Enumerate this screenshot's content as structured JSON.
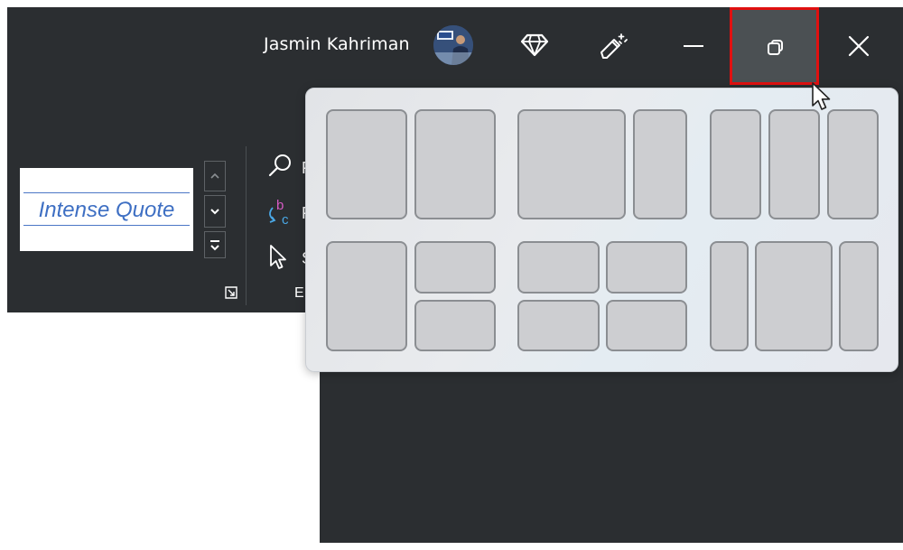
{
  "titlebar": {
    "user_name": "Jasmin Kahriman",
    "avatar": "user-avatar",
    "icons": [
      "diamond-icon",
      "pen-sparkle-icon",
      "minimize-icon",
      "restore-icon",
      "close-icon"
    ],
    "highlight_color": "#e01010"
  },
  "ribbon": {
    "style_gallery": {
      "selected_style": "Intense Quote"
    },
    "editing": {
      "find_label": "F",
      "replace_label": "F",
      "select_label": "S",
      "group_label": "E"
    }
  },
  "snap_layouts": {
    "layouts": [
      {
        "name": "two-equal-columns",
        "zones": 2
      },
      {
        "name": "wide-left-narrow-right",
        "zones": 2
      },
      {
        "name": "three-columns",
        "zones": 3
      },
      {
        "name": "left-column-right-stacked",
        "zones": 3
      },
      {
        "name": "four-grid",
        "zones": 4
      },
      {
        "name": "narrow-wide-narrow",
        "zones": 3
      }
    ]
  },
  "colors": {
    "dark_bg": "#2b2e31",
    "style_text": "#3e6fc3",
    "flyout_bg": "#e6e8eb"
  }
}
